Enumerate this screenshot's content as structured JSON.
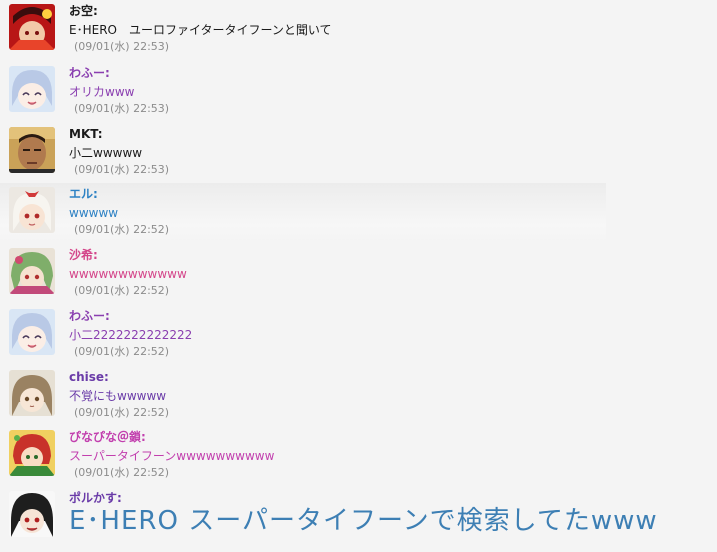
{
  "messages": [
    {
      "name": "お空:",
      "text": "E･HERO　ユーロファイタータイフーンと聞いて",
      "time": "(09/01(水) 22:53)",
      "name_color": "#1a1a1a",
      "text_color": "#1a1a1a",
      "avatar": "okuu-avatar"
    },
    {
      "name": "わふー:",
      "text": "オリカwww",
      "time": "(09/01(水) 22:53)",
      "name_color": "#8a3fb0",
      "text_color": "#8a3fb0",
      "avatar": "wafu-avatar"
    },
    {
      "name": "MKT:",
      "text": "小二wwwww",
      "time": "(09/01(水) 22:53)",
      "name_color": "#1a1a1a",
      "text_color": "#1a1a1a",
      "avatar": "mkt-avatar"
    },
    {
      "name": "エル:",
      "text": "wwwww",
      "time": "(09/01(水) 22:52)",
      "name_color": "#2e82c4",
      "text_color": "#2e82c4",
      "avatar": "eru-avatar"
    },
    {
      "name": "沙希:",
      "text": "wwwwwwwwwwww",
      "time": "(09/01(水) 22:52)",
      "name_color": "#d4458a",
      "text_color": "#d4458a",
      "avatar": "saki-avatar"
    },
    {
      "name": "わふー:",
      "text": "小二2222222222222",
      "time": "(09/01(水) 22:52)",
      "name_color": "#8a3fb0",
      "text_color": "#8a3fb0",
      "avatar": "wafu-avatar"
    },
    {
      "name": "chise:",
      "text": "不覚にもwwwww",
      "time": "(09/01(水) 22:52)",
      "name_color": "#6a3ba8",
      "text_color": "#6a3ba8",
      "avatar": "chise-avatar"
    },
    {
      "name": "ぴなぴな＠鎖:",
      "text": "スーパータイフーンwwwwwwwwww",
      "time": "(09/01(水) 22:52)",
      "name_color": "#c23fae",
      "text_color": "#c23fae",
      "avatar": "pinapina-avatar"
    },
    {
      "name": "ポルかす:",
      "text": "E･HERO スーパータイフーンで検索してたwww",
      "time": "",
      "name_color": "#6a3ba8",
      "text_color": "#3d7fb4",
      "avatar": "porukasu-avatar"
    }
  ]
}
